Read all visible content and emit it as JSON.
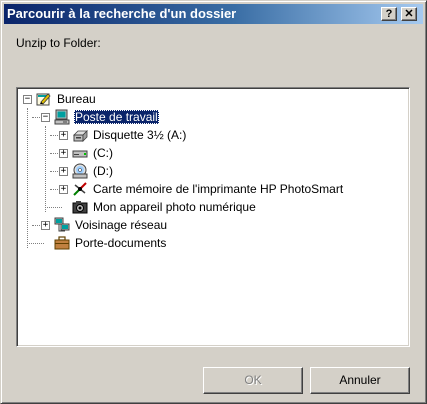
{
  "window": {
    "title": "Parcourir à la recherche d'un dossier",
    "help_label": "?",
    "close_label": "✕"
  },
  "prompt": "Unzip to Folder:",
  "tree": {
    "desktop": {
      "label": "Bureau",
      "icon": "desktop-icon",
      "expander": "−"
    },
    "my_computer": {
      "label": "Poste de travail",
      "icon": "computer-icon",
      "expander": "−",
      "selected": true
    },
    "floppy": {
      "label": "Disquette 3½ (A:)",
      "icon": "floppy-drive-icon",
      "expander": "+"
    },
    "drive_c": {
      "label": "(C:)",
      "icon": "hard-drive-icon",
      "expander": "+"
    },
    "drive_d": {
      "label": "(D:)",
      "icon": "cd-drive-icon",
      "expander": "+"
    },
    "memory_card": {
      "label": "Carte mémoire de l'imprimante HP PhotoSmart",
      "icon": "memory-card-icon",
      "expander": "+"
    },
    "camera": {
      "label": "Mon appareil photo numérique",
      "icon": "camera-icon"
    },
    "network": {
      "label": "Voisinage réseau",
      "icon": "network-icon",
      "expander": "+"
    },
    "briefcase": {
      "label": "Porte-documents",
      "icon": "briefcase-icon"
    }
  },
  "buttons": {
    "ok": {
      "label": "OK",
      "disabled": true
    },
    "cancel": {
      "label": "Annuler"
    }
  }
}
